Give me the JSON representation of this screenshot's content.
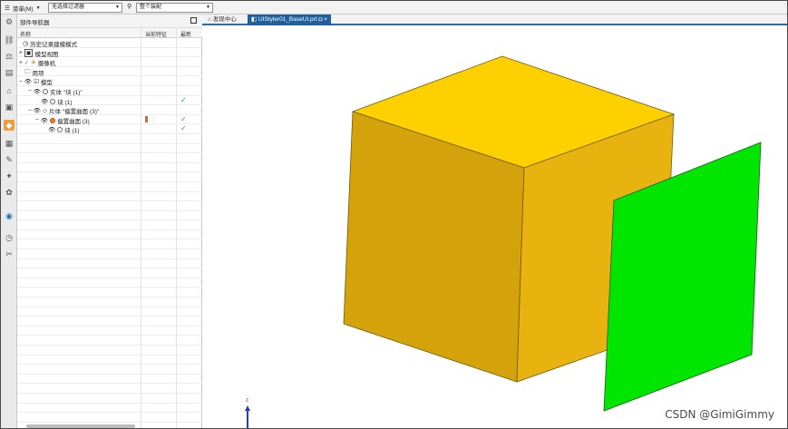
{
  "topbar": {
    "menu_icon": "hamburger-icon",
    "menu_label": "菜单(M)",
    "filter_value": "无选择过滤器",
    "assembly_value": "整个装配"
  },
  "navigator": {
    "title": "部件导航器",
    "columns": [
      "名称",
      "当前特征",
      "最新"
    ],
    "rows": [
      {
        "label": "历史记录建模模式",
        "indent": 0,
        "icon": "clock-icon",
        "check": ""
      },
      {
        "label": "模型视图",
        "indent": 0,
        "icon": "view-icon",
        "check": ""
      },
      {
        "label": "摄像机",
        "indent": 0,
        "icon": "camera-icon",
        "check": ""
      },
      {
        "label": "用项",
        "indent": 0,
        "icon": "folder-icon",
        "check": ""
      },
      {
        "label": "模型",
        "indent": 0,
        "icon": "model-icon",
        "check": ""
      },
      {
        "label": "实体 \"块 (1)\"",
        "indent": 1,
        "icon": "solid-icon",
        "check": ""
      },
      {
        "label": "块 (1)",
        "indent": 2,
        "icon": "block-icon",
        "check": "✓"
      },
      {
        "label": "片体 \"偏置曲面 (3)\"",
        "indent": 1,
        "icon": "sheet-icon",
        "check": ""
      },
      {
        "label": "偏置曲面 (3)",
        "indent": 2,
        "icon": "offset-icon",
        "check": "✓",
        "current": true
      },
      {
        "label": "块 (1)",
        "indent": 3,
        "icon": "block-icon",
        "check": "✓"
      }
    ]
  },
  "tabs": {
    "home_label": "发现中心",
    "active_label": "UIStyler01_BaseUI.prt",
    "close_glyph": "×"
  },
  "viewport": {
    "triad_label": "Z",
    "watermark": "CSDN @GimiGimmy"
  },
  "colors": {
    "cube_top": "#ffd000",
    "cube_front": "#d4a20a",
    "cube_side": "#e8b30e",
    "sheet": "#00e600",
    "tab_active": "#1f5f9c"
  }
}
